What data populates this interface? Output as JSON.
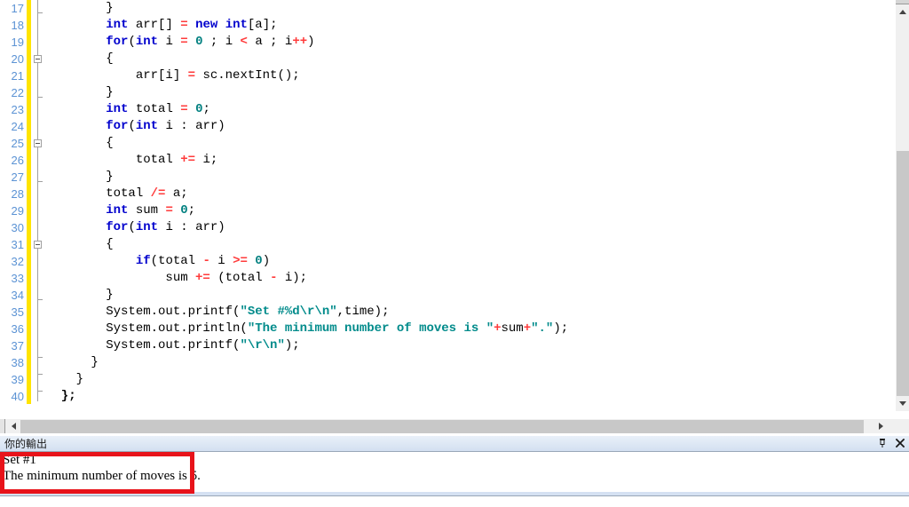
{
  "editor": {
    "first_line_number": 17,
    "lines": [
      {
        "num": "17",
        "fold": "tick-mid",
        "tokens": [
          {
            "t": "plain",
            "v": "        }"
          }
        ]
      },
      {
        "num": "18",
        "fold": "rail",
        "tokens": [
          {
            "t": "plain",
            "v": "        "
          },
          {
            "t": "kw",
            "v": "int"
          },
          {
            "t": "plain",
            "v": " arr[] "
          },
          {
            "t": "op",
            "v": "="
          },
          {
            "t": "plain",
            "v": " "
          },
          {
            "t": "kw",
            "v": "new"
          },
          {
            "t": "plain",
            "v": " "
          },
          {
            "t": "kw",
            "v": "int"
          },
          {
            "t": "plain",
            "v": "[a];"
          }
        ]
      },
      {
        "num": "19",
        "fold": "rail",
        "tokens": [
          {
            "t": "plain",
            "v": "        "
          },
          {
            "t": "kw",
            "v": "for"
          },
          {
            "t": "plain",
            "v": "("
          },
          {
            "t": "kw",
            "v": "int"
          },
          {
            "t": "plain",
            "v": " i "
          },
          {
            "t": "op",
            "v": "="
          },
          {
            "t": "plain",
            "v": " "
          },
          {
            "t": "num",
            "v": "0"
          },
          {
            "t": "plain",
            "v": " ; i "
          },
          {
            "t": "op",
            "v": "<"
          },
          {
            "t": "plain",
            "v": " a ; i"
          },
          {
            "t": "op",
            "v": "++"
          },
          {
            "t": "plain",
            "v": ")"
          }
        ]
      },
      {
        "num": "20",
        "fold": "box",
        "tokens": [
          {
            "t": "plain",
            "v": "        {"
          }
        ]
      },
      {
        "num": "21",
        "fold": "rail",
        "tokens": [
          {
            "t": "plain",
            "v": "            arr[i] "
          },
          {
            "t": "op",
            "v": "="
          },
          {
            "t": "plain",
            "v": " sc.nextInt();"
          }
        ]
      },
      {
        "num": "22",
        "fold": "tick-mid",
        "tokens": [
          {
            "t": "plain",
            "v": "        }"
          }
        ]
      },
      {
        "num": "23",
        "fold": "rail",
        "tokens": [
          {
            "t": "plain",
            "v": "        "
          },
          {
            "t": "kw",
            "v": "int"
          },
          {
            "t": "plain",
            "v": " total "
          },
          {
            "t": "op",
            "v": "="
          },
          {
            "t": "plain",
            "v": " "
          },
          {
            "t": "num",
            "v": "0"
          },
          {
            "t": "plain",
            "v": ";"
          }
        ]
      },
      {
        "num": "24",
        "fold": "rail",
        "tokens": [
          {
            "t": "plain",
            "v": "        "
          },
          {
            "t": "kw",
            "v": "for"
          },
          {
            "t": "plain",
            "v": "("
          },
          {
            "t": "kw",
            "v": "int"
          },
          {
            "t": "plain",
            "v": " i : arr)"
          }
        ]
      },
      {
        "num": "25",
        "fold": "box",
        "tokens": [
          {
            "t": "plain",
            "v": "        {"
          }
        ]
      },
      {
        "num": "26",
        "fold": "rail",
        "tokens": [
          {
            "t": "plain",
            "v": "            total "
          },
          {
            "t": "op",
            "v": "+="
          },
          {
            "t": "plain",
            "v": " i;"
          }
        ]
      },
      {
        "num": "27",
        "fold": "tick-mid",
        "tokens": [
          {
            "t": "plain",
            "v": "        }"
          }
        ]
      },
      {
        "num": "28",
        "fold": "rail",
        "tokens": [
          {
            "t": "plain",
            "v": "        total "
          },
          {
            "t": "op",
            "v": "/="
          },
          {
            "t": "plain",
            "v": " a;"
          }
        ]
      },
      {
        "num": "29",
        "fold": "rail",
        "tokens": [
          {
            "t": "plain",
            "v": "        "
          },
          {
            "t": "kw",
            "v": "int"
          },
          {
            "t": "plain",
            "v": " sum "
          },
          {
            "t": "op",
            "v": "="
          },
          {
            "t": "plain",
            "v": " "
          },
          {
            "t": "num",
            "v": "0"
          },
          {
            "t": "plain",
            "v": ";"
          }
        ]
      },
      {
        "num": "30",
        "fold": "rail",
        "tokens": [
          {
            "t": "plain",
            "v": "        "
          },
          {
            "t": "kw",
            "v": "for"
          },
          {
            "t": "plain",
            "v": "("
          },
          {
            "t": "kw",
            "v": "int"
          },
          {
            "t": "plain",
            "v": " i : arr)"
          }
        ]
      },
      {
        "num": "31",
        "fold": "box",
        "tokens": [
          {
            "t": "plain",
            "v": "        {"
          }
        ]
      },
      {
        "num": "32",
        "fold": "rail",
        "tokens": [
          {
            "t": "plain",
            "v": "            "
          },
          {
            "t": "kw",
            "v": "if"
          },
          {
            "t": "plain",
            "v": "(total "
          },
          {
            "t": "op",
            "v": "-"
          },
          {
            "t": "plain",
            "v": " i "
          },
          {
            "t": "op",
            "v": ">="
          },
          {
            "t": "plain",
            "v": " "
          },
          {
            "t": "num",
            "v": "0"
          },
          {
            "t": "plain",
            "v": ")"
          }
        ]
      },
      {
        "num": "33",
        "fold": "rail",
        "tokens": [
          {
            "t": "plain",
            "v": "                sum "
          },
          {
            "t": "op",
            "v": "+="
          },
          {
            "t": "plain",
            "v": " (total "
          },
          {
            "t": "op",
            "v": "-"
          },
          {
            "t": "plain",
            "v": " i);"
          }
        ]
      },
      {
        "num": "34",
        "fold": "tick-mid",
        "tokens": [
          {
            "t": "plain",
            "v": "        }"
          }
        ]
      },
      {
        "num": "35",
        "fold": "rail",
        "tokens": [
          {
            "t": "plain",
            "v": "        System.out.printf("
          },
          {
            "t": "str",
            "v": "\"Set #%d\\r\\n\""
          },
          {
            "t": "plain",
            "v": ",time);"
          }
        ]
      },
      {
        "num": "36",
        "fold": "rail",
        "tokens": [
          {
            "t": "plain",
            "v": "        System.out.println("
          },
          {
            "t": "str",
            "v": "\"The minimum number of moves is \""
          },
          {
            "t": "op",
            "v": "+"
          },
          {
            "t": "plain",
            "v": "sum"
          },
          {
            "t": "op",
            "v": "+"
          },
          {
            "t": "str",
            "v": "\".\""
          },
          {
            "t": "plain",
            "v": ");"
          }
        ]
      },
      {
        "num": "37",
        "fold": "rail",
        "tokens": [
          {
            "t": "plain",
            "v": "        System.out.printf("
          },
          {
            "t": "str",
            "v": "\"\\r\\n\""
          },
          {
            "t": "plain",
            "v": ");"
          }
        ]
      },
      {
        "num": "38",
        "fold": "tick-top",
        "tokens": [
          {
            "t": "plain",
            "v": "      }"
          }
        ]
      },
      {
        "num": "39",
        "fold": "tick-top",
        "tokens": [
          {
            "t": "plain",
            "v": "    }"
          }
        ]
      },
      {
        "num": "40",
        "fold": "tick-top",
        "tokens": [
          {
            "t": "bold",
            "v": "  };"
          }
        ]
      }
    ],
    "vscrollbar": {
      "up_arrow": "scroll-up-arrow",
      "down_arrow": "scroll-down-arrow"
    },
    "hscrollbar": {
      "left_arrow": "scroll-left-arrow",
      "right_arrow": "scroll-right-arrow"
    }
  },
  "output_panel": {
    "title": "你的輸出",
    "pin_icon": "pin-icon",
    "close_icon": "close-icon",
    "lines": [
      "Set #1",
      "The minimum number of moves is 5."
    ]
  },
  "annotation": {
    "color": "#e8131a",
    "shape": "rectangle"
  },
  "colors": {
    "keyword": "#0000cd",
    "string": "#008b8b",
    "number": "#008080",
    "operator": "#ff3b3b",
    "line_number": "#5c93d4",
    "change_bar": "#ffe400",
    "panel_header": "#d3e0f1"
  }
}
